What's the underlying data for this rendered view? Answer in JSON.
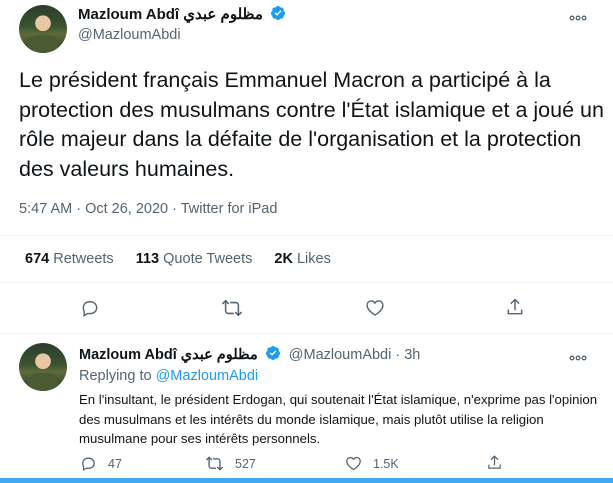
{
  "main_tweet": {
    "display_name": "Mazloum Abdî مظلوم عبدي",
    "handle": "@MazloumAbdi",
    "text": "Le président français Emmanuel Macron a participé à la protection des musulmans contre l'État islamique et a joué un rôle majeur dans la défaite de l'organisation et la protection des valeurs humaines.",
    "time": "5:47 AM · Oct 26, 2020 · Twitter for iPad",
    "stats": [
      {
        "count": "674",
        "label": "Retweets"
      },
      {
        "count": "113",
        "label": "Quote Tweets"
      },
      {
        "count": "2K",
        "label": "Likes"
      }
    ],
    "actions": [
      "reply-icon",
      "retweet-icon",
      "like-icon",
      "share-icon"
    ]
  },
  "reply_tweet": {
    "display_name": "Mazloum Abdî مظلوم عبدي",
    "handle_time": "@MazloumAbdi · 3h",
    "replying_label": "Replying to",
    "replying_to": "@MazloumAbdi",
    "text": "En l'insultant, le président Erdogan, qui soutenait l'État islamique, n'exprime pas l'opinion des musulmans et les intérêts du monde islamique, mais plutôt utilise la religion musulmane pour ses intérêts personnels.",
    "reply_count": "47",
    "retweet_count": "527",
    "like_count": "1.5K"
  },
  "colors": {
    "verified": "#1d9bf0",
    "link": "#1d9bf0",
    "muted": "#536471",
    "text": "#0f1419"
  }
}
